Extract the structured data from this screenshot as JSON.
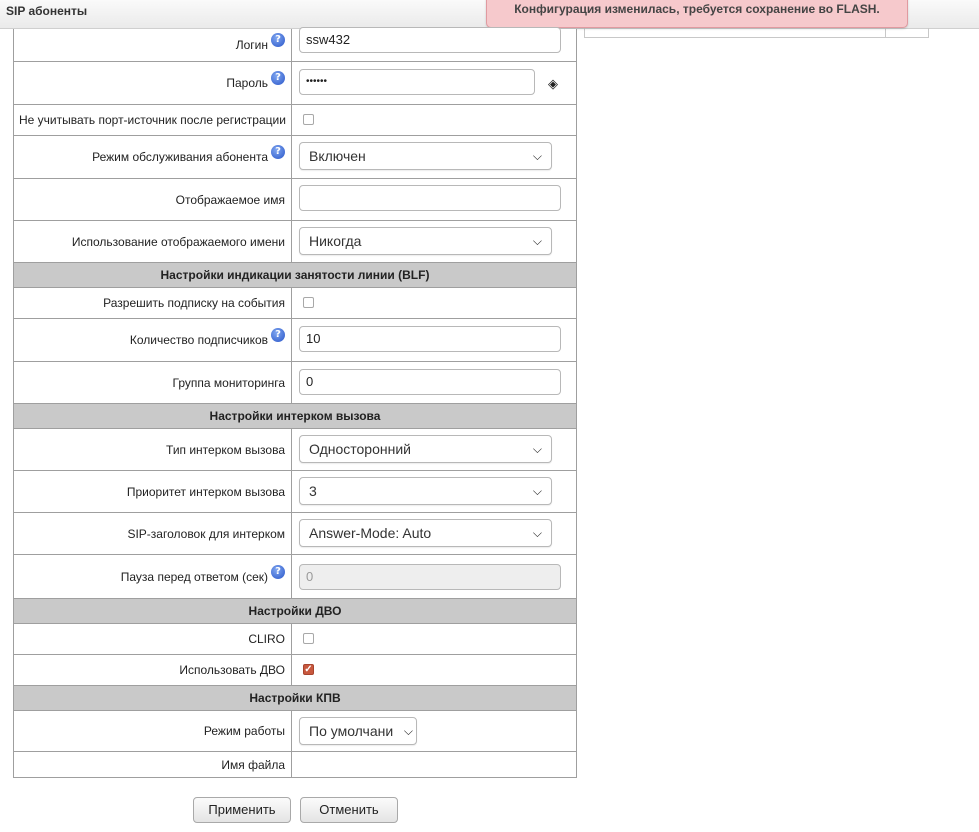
{
  "header": {
    "title": "SIP абоненты"
  },
  "notification": {
    "text": "Конфигурация изменилась, требуется сохранение во FLASH."
  },
  "form": {
    "login": {
      "label": "Логин",
      "value": "ssw432"
    },
    "password": {
      "label": "Пароль",
      "value": "••••••"
    },
    "ignore_source_port": {
      "label": "Не учитывать порт-источник после регистрации",
      "checked": false
    },
    "service_mode": {
      "label": "Режим обслуживания абонента",
      "value": "Включен"
    },
    "display_name": {
      "label": "Отображаемое имя",
      "value": ""
    },
    "display_name_usage": {
      "label": "Использование отображаемого имени",
      "value": "Никогда"
    },
    "blf_section": "Настройки индикации занятости линии (BLF)",
    "allow_subscribe": {
      "label": "Разрешить подписку на события",
      "checked": false
    },
    "subscribers_count": {
      "label": "Количество подписчиков",
      "value": "10"
    },
    "monitoring_group": {
      "label": "Группа мониторинга",
      "value": "0"
    },
    "intercom_section": "Настройки интерком вызова",
    "intercom_type": {
      "label": "Тип интерком вызова",
      "value": "Односторонний"
    },
    "intercom_priority": {
      "label": "Приоритет интерком вызова",
      "value": "3"
    },
    "intercom_header": {
      "label": "SIP-заголовок для интерком",
      "value": "Answer-Mode: Auto"
    },
    "answer_pause": {
      "label": "Пауза перед ответом (сек)",
      "value": "0"
    },
    "dvo_section": "Настройки ДВО",
    "cliro": {
      "label": "CLIRO",
      "checked": false
    },
    "use_dvo": {
      "label": "Использовать ДВО",
      "checked": true
    },
    "kpv_section": "Настройки КПВ",
    "work_mode": {
      "label": "Режим работы",
      "value": "По умолчани"
    },
    "file_name": {
      "label": "Имя файла",
      "value": ""
    }
  },
  "buttons": {
    "apply": "Применить",
    "cancel": "Отменить"
  },
  "icons": {
    "help": "help-icon",
    "eye": "eye-slash-icon",
    "chevron": "chevron-down-icon",
    "check": "check-icon"
  },
  "colors": {
    "section_bg": "#c9c9c9",
    "notice_bg": "#f6c9cc",
    "checked": "#c8583e",
    "help": "#2a56c9"
  }
}
